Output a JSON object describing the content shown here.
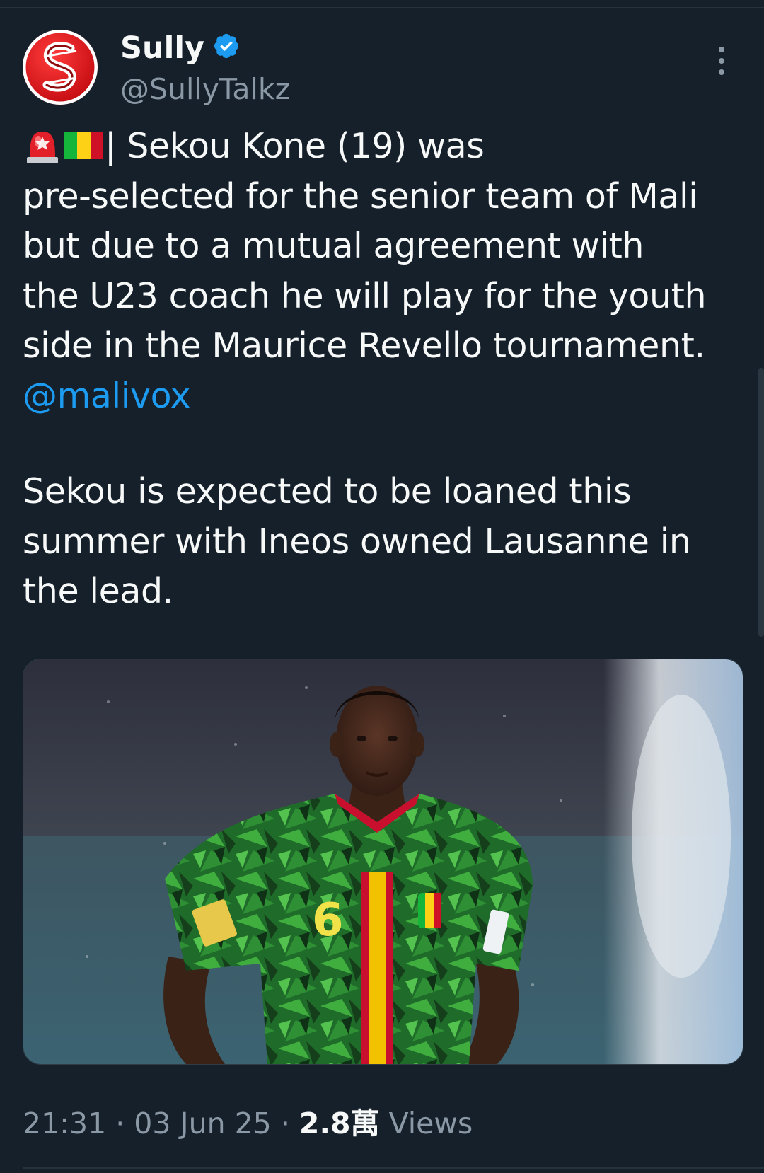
{
  "author": {
    "display_name": "Sully",
    "handle": "@SullyTalkz",
    "avatar_letter": "S"
  },
  "tweet": {
    "lines_1": [
      "| Sekou Kone (19) was",
      "pre-selected for the senior team of Mali",
      "but due to a mutual agreement with",
      "the U23 coach he will play for the youth",
      "side in the Maurice Revello tournament."
    ],
    "mention": "@malivox",
    "lines_2": [
      "Sekou is expected to be loaned this",
      "summer with Ineos owned Lausanne in",
      "the lead."
    ],
    "emojis": [
      "siren-emoji",
      "mali-flag-emoji"
    ]
  },
  "media": {
    "jersey_number": "6",
    "alt": "Player in green Mali jersey number 6"
  },
  "meta": {
    "time": "21:31",
    "separator": "·",
    "date": "03 Jun 25",
    "views_count": "2.8萬",
    "views_label": "Views"
  },
  "colors": {
    "background": "#15202b",
    "text": "#f7f9f9",
    "secondary": "#8b98a5",
    "link": "#1d9bf0",
    "verified": "#1d9bf0",
    "avatar_red": "#d4161b"
  }
}
